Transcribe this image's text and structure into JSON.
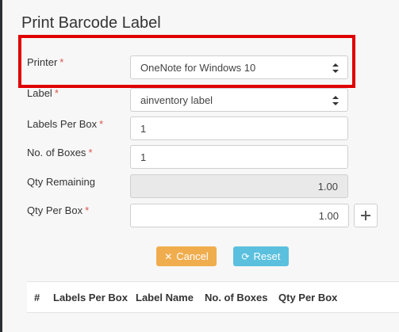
{
  "page": {
    "title": "Print Barcode Label"
  },
  "form": {
    "printer": {
      "label": "Printer",
      "required": "*",
      "value": "OneNote for Windows 10"
    },
    "label": {
      "label": "Label",
      "required": "*",
      "value": "ainventory label"
    },
    "labels_per_box": {
      "label": "Labels Per Box",
      "required": "*",
      "value": "1"
    },
    "no_of_boxes": {
      "label": "No. of Boxes",
      "required": "*",
      "value": "1"
    },
    "qty_remaining": {
      "label": "Qty Remaining",
      "value": "1.00"
    },
    "qty_per_box": {
      "label": "Qty Per Box",
      "required": "*",
      "value": "1.00"
    }
  },
  "buttons": {
    "add": "+",
    "cancel": {
      "label": "Cancel",
      "icon": "times-icon"
    },
    "reset": {
      "label": "Reset",
      "icon": "refresh-icon"
    }
  },
  "table": {
    "columns": [
      "#",
      "Labels Per Box",
      "Label Name",
      "No. of Boxes",
      "Qty Per Box"
    ]
  },
  "colors": {
    "highlight": "#e00000",
    "cancel": "#f0ad4e",
    "reset": "#5bc0de",
    "required": "#d9534f"
  }
}
